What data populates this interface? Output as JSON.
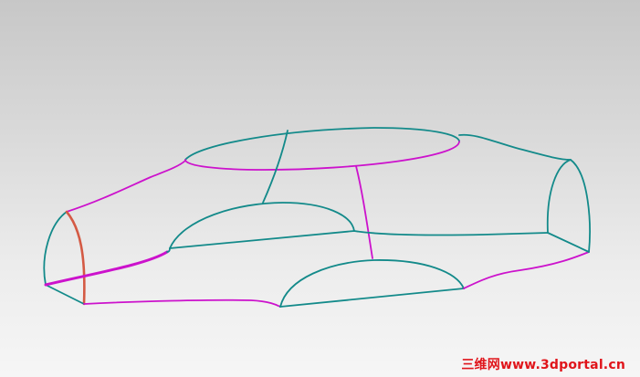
{
  "viewport": {
    "background_top": "#c7c7c7",
    "background_bottom": "#f6f6f6"
  },
  "curve_colors": {
    "teal": "#138a8a",
    "magenta": "#cc12cc",
    "red": "#d45a44"
  },
  "watermark": {
    "text": "三维网www.3dportal.cn",
    "color": "#e0151b"
  }
}
